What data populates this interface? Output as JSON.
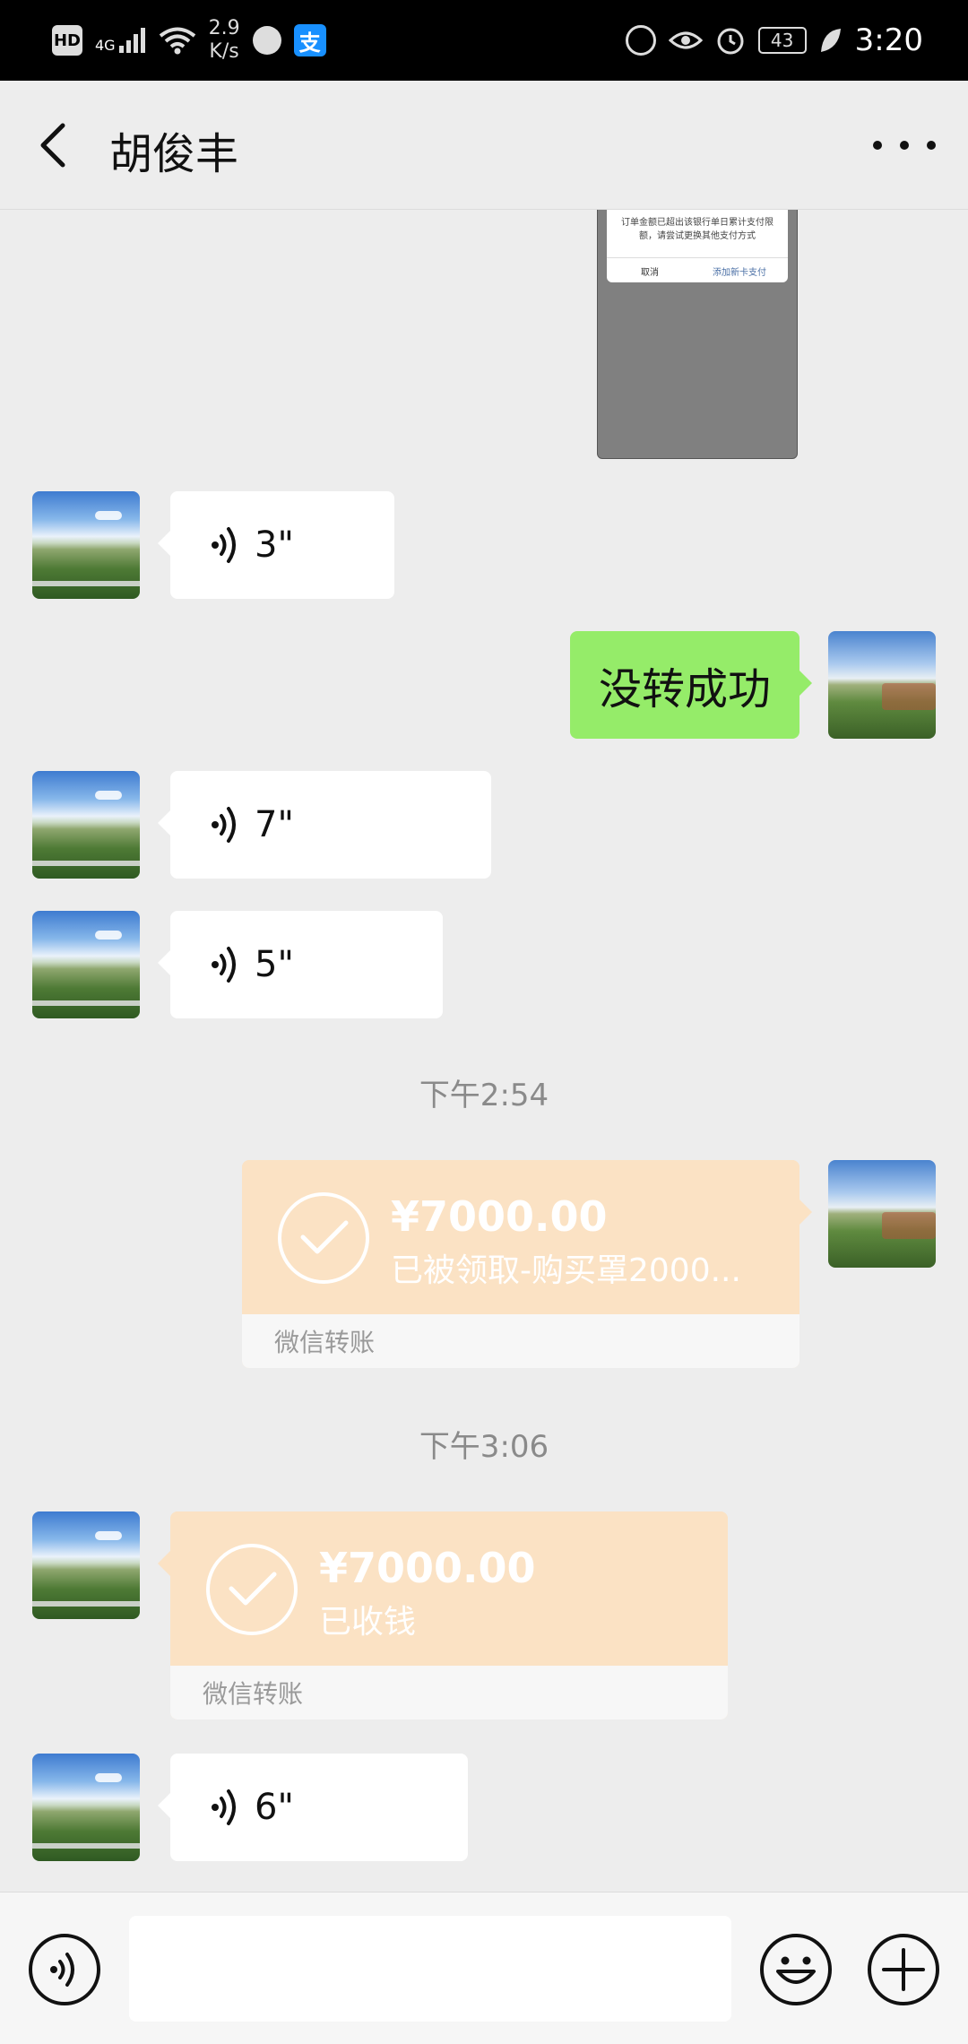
{
  "status_bar": {
    "hd": "HD",
    "network": "4G",
    "speed_value": "2.9",
    "speed_unit": "K/s",
    "alipay_icon": "支",
    "battery": "43",
    "time": "3:20"
  },
  "header": {
    "title": "胡俊丰"
  },
  "screenshot_preview": {
    "message": "订单金额已超出该银行单日累计支付限额，请尝试更换其他支付方式",
    "cancel": "取消",
    "add_card": "添加新卡支付"
  },
  "messages": [
    {
      "type": "voice",
      "side": "left",
      "duration": "3\""
    },
    {
      "type": "text",
      "side": "right",
      "text": "没转成功"
    },
    {
      "type": "voice",
      "side": "left",
      "duration": "7\""
    },
    {
      "type": "voice",
      "side": "left",
      "duration": "5\""
    },
    {
      "type": "time",
      "text": "下午2:54"
    },
    {
      "type": "transfer",
      "side": "right",
      "amount": "¥7000.00",
      "note": "已被领取-购买罩2000...",
      "footer": "微信转账"
    },
    {
      "type": "time",
      "text": "下午3:06"
    },
    {
      "type": "transfer",
      "side": "left",
      "amount": "¥7000.00",
      "note": "已收钱",
      "footer": "微信转账"
    },
    {
      "type": "voice",
      "side": "left",
      "duration": "6\""
    }
  ],
  "icons": {
    "back": "chevron-left-icon",
    "more": "more-icon",
    "voice": "voice-icon",
    "emoji": "emoji-icon",
    "plus": "plus-icon",
    "check": "check-icon"
  },
  "colors": {
    "background": "#ededed",
    "my_bubble": "#95ec69",
    "transfer": "#fbe2c4",
    "status_bar": "#000000"
  }
}
